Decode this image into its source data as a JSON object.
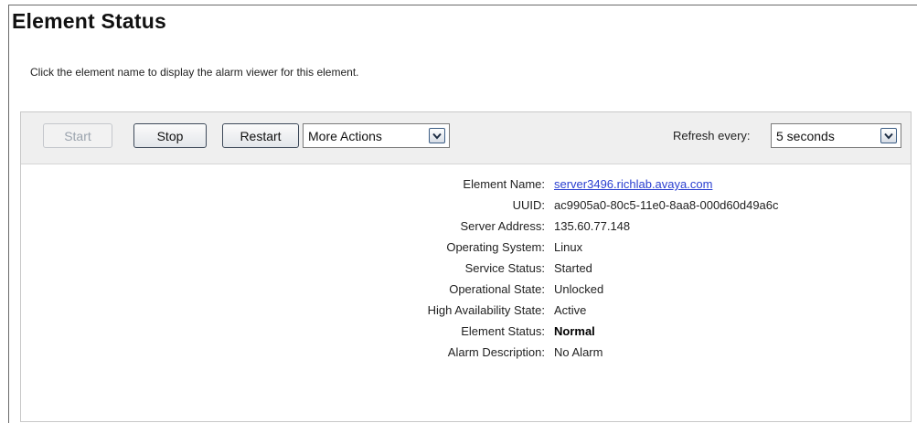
{
  "page": {
    "title": "Element Status",
    "instruction": "Click the element name to display the alarm viewer for this element."
  },
  "toolbar": {
    "start_label": "Start",
    "stop_label": "Stop",
    "restart_label": "Restart",
    "more_actions": {
      "selected": "More Actions",
      "icon": "chevron-down-icon"
    },
    "refresh_label": "Refresh every:",
    "refresh_select": {
      "selected": "5 seconds",
      "icon": "chevron-down-icon"
    }
  },
  "details": {
    "element_name": {
      "label": "Element Name:",
      "value": "server3496.richlab.avaya.com"
    },
    "uuid": {
      "label": "UUID:",
      "value": "ac9905a0-80c5-11e0-8aa8-000d60d49a6c"
    },
    "server_address": {
      "label": "Server Address:",
      "value": "135.60.77.148"
    },
    "operating_system": {
      "label": "Operating System:",
      "value": "Linux"
    },
    "service_status": {
      "label": "Service Status:",
      "value": "Started"
    },
    "operational_state": {
      "label": "Operational State:",
      "value": "Unlocked"
    },
    "ha_state": {
      "label": "High Availability State:",
      "value": "Active"
    },
    "element_status": {
      "label": "Element Status:",
      "value": "Normal"
    },
    "alarm_description": {
      "label": "Alarm Description:",
      "value": "No Alarm"
    }
  },
  "colors": {
    "link": "#2a3fd0",
    "toolbar_bg": "#efefef",
    "button_border": "#3e4a5a"
  }
}
